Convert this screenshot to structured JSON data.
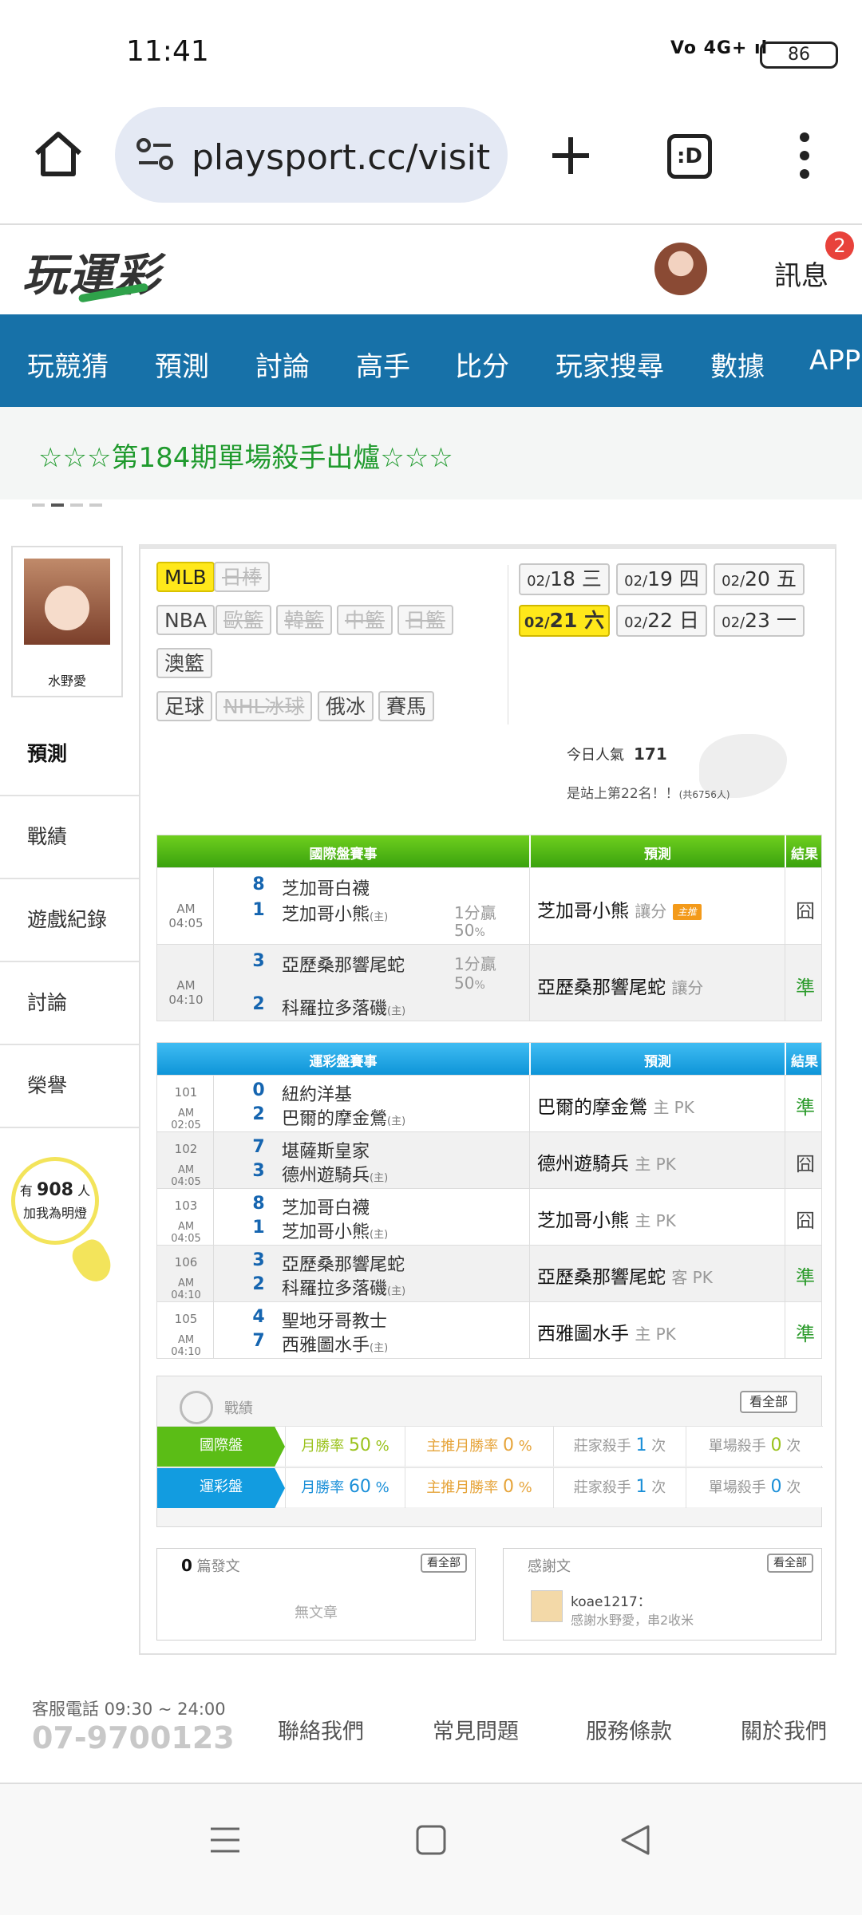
{
  "status_bar": {
    "time": "11:41",
    "signal": "Vo 4G+ ıl",
    "battery": "86"
  },
  "browser": {
    "url": "playsport.cc/visit",
    "tab_count": ":D"
  },
  "header": {
    "logo": "玩運彩",
    "messages_label": "訊息",
    "messages_badge": "2"
  },
  "nav": {
    "items": [
      "玩競猜",
      "預測",
      "討論",
      "高手",
      "比分",
      "玩家搜尋",
      "數據",
      "APP"
    ]
  },
  "announcement": {
    "text": "☆☆☆第184期單場殺手出爐☆☆☆"
  },
  "profile": {
    "name": "水野愛"
  },
  "side_menu": {
    "items": [
      "預測",
      "戰績",
      "遊戲紀錄",
      "討論",
      "榮譽"
    ]
  },
  "fans": {
    "prefix": "有",
    "count": "908",
    "suffix": "人",
    "caption": "加我為明燈"
  },
  "leagues": {
    "row1": [
      {
        "label": "MLB",
        "state": "on"
      },
      {
        "label": "日棒",
        "state": "dis"
      }
    ],
    "row2": [
      {
        "label": "NBA",
        "state": "en"
      },
      {
        "label": "歐籃",
        "state": "dis"
      },
      {
        "label": "韓籃",
        "state": "dis"
      },
      {
        "label": "中籃",
        "state": "dis"
      },
      {
        "label": "日籃",
        "state": "dis"
      }
    ],
    "row3": [
      {
        "label": "澳籃",
        "state": "en"
      }
    ],
    "row4": [
      {
        "label": "足球",
        "state": "en"
      },
      {
        "label": "NHL冰球",
        "state": "dis"
      },
      {
        "label": "俄冰",
        "state": "en"
      },
      {
        "label": "賽馬",
        "state": "en"
      }
    ]
  },
  "dates": [
    {
      "md": "02/",
      "d": "18",
      "w": "三"
    },
    {
      "md": "02/",
      "d": "19",
      "w": "四"
    },
    {
      "md": "02/",
      "d": "20",
      "w": "五"
    },
    {
      "md": "02/",
      "d": "21",
      "w": "六",
      "active": true
    },
    {
      "md": "02/",
      "d": "22",
      "w": "日"
    },
    {
      "md": "02/",
      "d": "23",
      "w": "一"
    }
  ],
  "popularity": {
    "label": "今日人氣",
    "value": "171",
    "rank": "是站上第22名！！",
    "total": "(共6756人)"
  },
  "intl_table": {
    "headers": [
      "國際盤賽事",
      "預測",
      "結果"
    ],
    "rows": [
      {
        "time": "AM 04:05",
        "s1": "8",
        "t1": "芝加哥白襪",
        "s2": "1",
        "t2": "芝加哥小熊",
        "home": "(主)",
        "hc1": "1分贏",
        "hc2": "50",
        "pct": "%",
        "pick": "芝加哥小熊",
        "pick_note": "讓分",
        "mark": "主推",
        "result": "囧"
      },
      {
        "time": "AM 04:10",
        "s1": "3",
        "t1": "亞歷桑那響尾蛇",
        "s2": "2",
        "t2": "科羅拉多落磯",
        "home": "(主)",
        "hc1": "1分贏",
        "hc2": "50",
        "pct": "%",
        "pick": "亞歷桑那響尾蛇",
        "pick_note": "讓分",
        "result": "準"
      }
    ]
  },
  "lottery_table": {
    "headers": [
      "運彩盤賽事",
      "預測",
      "結果"
    ],
    "rows": [
      {
        "no": "101",
        "time": "AM 02:05",
        "s1": "0",
        "t1": "紐約洋基",
        "s2": "2",
        "t2": "巴爾的摩金鶯",
        "home": "(主)",
        "pick": "巴爾的摩金鶯",
        "pick_note": "主 PK",
        "result": "準"
      },
      {
        "no": "102",
        "time": "AM 04:05",
        "s1": "7",
        "t1": "堪薩斯皇家",
        "s2": "3",
        "t2": "德州遊騎兵",
        "home": "(主)",
        "pick": "德州遊騎兵",
        "pick_note": "主 PK",
        "result": "囧"
      },
      {
        "no": "103",
        "time": "AM 04:05",
        "s1": "8",
        "t1": "芝加哥白襪",
        "s2": "1",
        "t2": "芝加哥小熊",
        "home": "(主)",
        "pick": "芝加哥小熊",
        "pick_note": "主 PK",
        "result": "囧"
      },
      {
        "no": "106",
        "time": "AM 04:10",
        "s1": "3",
        "t1": "亞歷桑那響尾蛇",
        "s2": "2",
        "t2": "科羅拉多落磯",
        "home": "(主)",
        "pick": "亞歷桑那響尾蛇",
        "pick_note": "客 PK",
        "result": "準"
      },
      {
        "no": "105",
        "time": "AM 04:10",
        "s1": "4",
        "t1": "聖地牙哥教士",
        "s2": "7",
        "t2": "西雅圖水手",
        "home": "(主)",
        "pick": "西雅圖水手",
        "pick_note": "主 PK",
        "result": "準"
      }
    ]
  },
  "record": {
    "title": "戰績",
    "see_all": "看全部",
    "rows": [
      {
        "label": "國際盤",
        "month": "月勝率",
        "month_val": "50",
        "main": "主推月勝率",
        "main_val": "0",
        "dealer": "莊家殺手",
        "dealer_val": "1",
        "single": "單場殺手",
        "single_val": "0",
        "pct": "%",
        "times": "次"
      },
      {
        "label": "運彩盤",
        "month": "月勝率",
        "month_val": "60",
        "main": "主推月勝率",
        "main_val": "0",
        "dealer": "莊家殺手",
        "dealer_val": "1",
        "single": "單場殺手",
        "single_val": "0",
        "pct": "%",
        "times": "次"
      }
    ]
  },
  "posts": {
    "count": "0",
    "label": "篇發文",
    "see_all": "看全部",
    "empty": "無文章"
  },
  "thanks": {
    "label": "感謝文",
    "see_all": "看全部",
    "user": "koae1217：",
    "message": "感謝水野愛，串2收米"
  },
  "footer": {
    "service": "客服電話 09:30 ~ 24:00",
    "phone": "07-9700123",
    "links": [
      "聯絡我們",
      "常見問題",
      "服務條款",
      "關於我們"
    ]
  },
  "colors": {
    "nav": "#1771a8",
    "green_header": "#3aa20e",
    "blue_header": "#0e95d8",
    "highlight": "#ffe81a",
    "win": "#2a9a2a"
  }
}
